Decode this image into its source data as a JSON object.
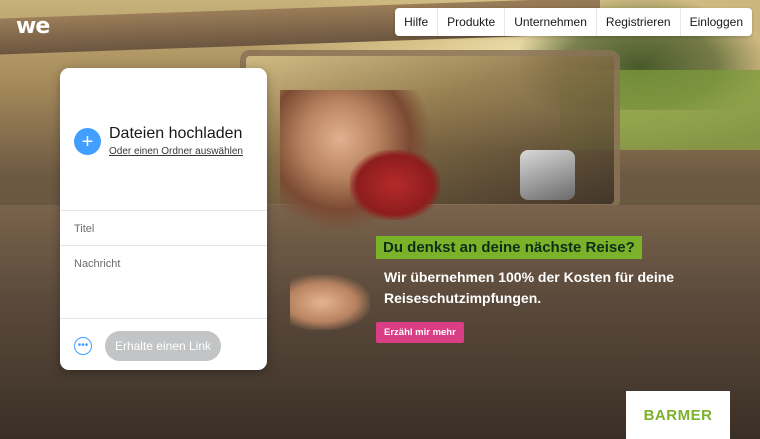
{
  "brand": {
    "logo_text": "we"
  },
  "nav": {
    "items": [
      "Hilfe",
      "Produkte",
      "Unternehmen",
      "Registrieren",
      "Einloggen"
    ]
  },
  "upload_panel": {
    "plus_icon": "plus-icon",
    "title": "Dateien hochladen",
    "subtitle": "Oder einen Ordner auswählen",
    "title_field_placeholder": "Titel",
    "message_field_placeholder": "Nachricht",
    "more_icon": "ellipsis-icon",
    "link_button": "Erhalte einen Link"
  },
  "ad": {
    "headline": "Du denkst an deine nächste Reise?",
    "body": "Wir übernehmen 100% der Kosten für deine Reiseschutzimpfungen.",
    "cta": "Erzähl mir mehr",
    "advertiser": "BARMER",
    "colors": {
      "headline_bg": "#7ab22a",
      "cta_bg": "#d93e85",
      "advertiser_text": "#7ab22a"
    }
  }
}
